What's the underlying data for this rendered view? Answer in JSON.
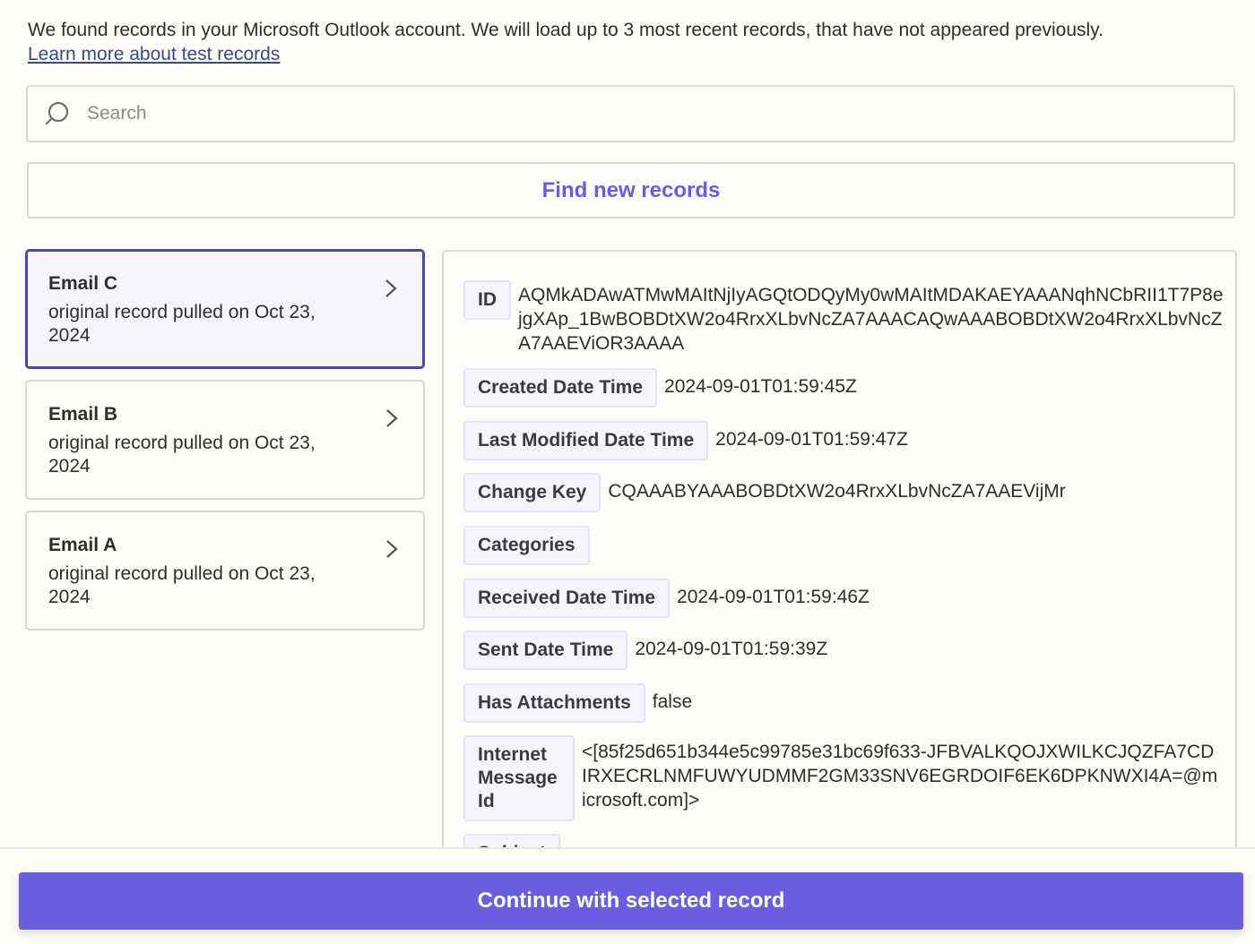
{
  "intro": {
    "text": "We found records in your Microsoft Outlook account. We will load up to 3 most recent records, that have not appeared previously.",
    "link": "Learn more about test records"
  },
  "search": {
    "placeholder": "Search",
    "value": "",
    "icon": "search-icon"
  },
  "find_button": {
    "label": "Find new records"
  },
  "records": [
    {
      "title": "Email C",
      "subtitle": "original record pulled on Oct 23, 2024",
      "selected": true
    },
    {
      "title": "Email B",
      "subtitle": "original record pulled on Oct 23, 2024",
      "selected": false
    },
    {
      "title": "Email A",
      "subtitle": "original record pulled on Oct 23, 2024",
      "selected": false
    }
  ],
  "detail": {
    "fields": [
      {
        "label": "ID",
        "value": "AQMkADAwATMwMAItNjIyAGQtODQyMy0wMAItMDAKAEYAAANqhNCbRII1T7P8ejgXAp_1BwBOBDtXW2o4RrxXLbvNcZA7AAACAQwAAABOBDtXW2o4RrxXLbvNcZA7AAEViOR3AAAA"
      },
      {
        "label": "Created Date Time",
        "value": "2024-09-01T01:59:45Z"
      },
      {
        "label": "Last Modified Date Time",
        "value": "2024-09-01T01:59:47Z"
      },
      {
        "label": "Change Key",
        "value": "CQAAABYAAABOBDtXW2o4RrxXLbvNcZA7AAEVijMr"
      },
      {
        "label": "Categories",
        "value": ""
      },
      {
        "label": "Received Date Time",
        "value": "2024-09-01T01:59:46Z"
      },
      {
        "label": "Sent Date Time",
        "value": "2024-09-01T01:59:39Z"
      },
      {
        "label": "Has Attachments",
        "value": "false"
      },
      {
        "label": "Internet Message Id",
        "value": "<[85f25d651b344e5c99785e31bc69f633-JFBVALKQOJXWILKCJQZFA7CDIRXECRLNMFUWYUDMMF2GM33SNV6EGRDOIF6EK6DPKNWXI4A=@microsoft.com]>"
      },
      {
        "label": "Subject",
        "value": ""
      }
    ]
  },
  "footer": {
    "continue_label": "Continue with selected record"
  },
  "colors": {
    "accent": "#695ee0",
    "selected_border": "#4b44b9",
    "link": "#3d4592"
  }
}
